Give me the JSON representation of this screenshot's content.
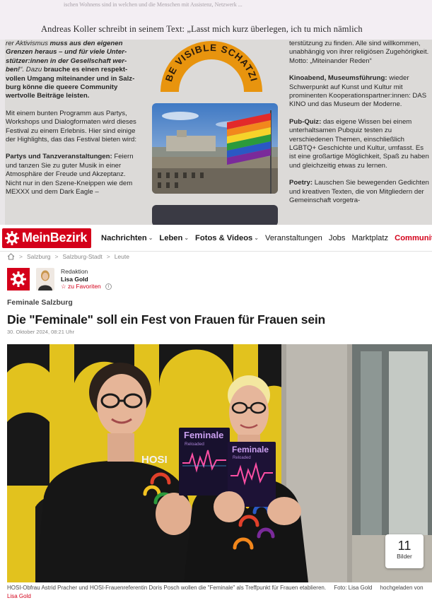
{
  "scan": {
    "faded_text": "ischen Wohnens sind in welchen und die Menschen mit Assistenz, Netzwerk ...",
    "quote_line": "Andreas Koller schreibt in seinem Text: „Lasst mich kurz überlegen, ich tu mich nämlich",
    "left_column": [
      {
        "html_parts": [
          {
            "t": "rer Aktivismus ",
            "s": "i"
          },
          {
            "t": "muss aus den eigenen Grenzen heraus – und für viele Unter­stützer:innen in der Gesellschaft wer­ben!",
            "s": "bi"
          },
          {
            "t": "“. Dazu ",
            "s": "i"
          },
          {
            "t": "brauche es einen respekt­vollen Umgang miteinander und in Salz­burg könne die queere Community wertvolle Beiträge leisten.",
            "s": "b"
          }
        ]
      },
      {
        "html_parts": [
          {
            "t": "Mit einem bunten Programm aus Par­tys, Workshops und Dialogformaten wird dieses Festival zu einem Erlebnis. Hier sind einige der Highlights, das das Festi­val bieten wird:",
            "s": ""
          }
        ]
      },
      {
        "html_parts": [
          {
            "t": "Partys und Tanzveranstaltungen: ",
            "s": "b"
          },
          {
            "t": "Feiern und tanzen Sie zu guter Musik in einer Atmosphäre der Freude und Akzep­tanz. Nicht nur in den Szene-Kneippen wie dem MEXXX und dem Dark Eagle –",
            "s": ""
          }
        ]
      }
    ],
    "right_column": [
      {
        "html_parts": [
          {
            "t": "terstützung zu finden. Alle sind willkom­men, unabhängig von ihrer religiösen Zu­gehörigkeit. Motto: „Miteinander Reden“",
            "s": ""
          }
        ]
      },
      {
        "html_parts": [
          {
            "t": "Kinoabend, Museumsführung: ",
            "s": "b"
          },
          {
            "t": "wieder Schwerpunkt auf Kunst und Kultur mit prominenten Kooperationspartner:in­nen: DAS KINO und das Museum der Moderne.",
            "s": ""
          }
        ]
      },
      {
        "html_parts": [
          {
            "t": "Pub-Quiz: ",
            "s": "b"
          },
          {
            "t": "das eigene Wissen bei ei­nem unterhaltsamen Pubquiz testen zu verschiedenen Themen, einschließlich LGBTQ+ Geschichte und Kultur, umfasst. Es ist eine großartige Möglichkeit, Spaß zu haben und gleichzeitig etwas zu ler­nen.",
            "s": ""
          }
        ]
      },
      {
        "html_parts": [
          {
            "t": "Poetry: ",
            "s": "b"
          },
          {
            "t": "Lauschen Sie bewegenden Gedichten und kreativen Texten, die von Mitgliedern der Gemeinschaft vorgetra-",
            "s": ""
          }
        ]
      }
    ],
    "badge_text": "BE VISIBLE SCHATZI"
  },
  "nav": {
    "logo_text": "MeinBezirk",
    "items": [
      {
        "label": "Nachrichten",
        "chevron": true,
        "style": "bold"
      },
      {
        "label": "Leben",
        "chevron": true,
        "style": "bold"
      },
      {
        "label": "Fotos & Videos",
        "chevron": true,
        "style": "bold"
      },
      {
        "label": "Veranstaltungen",
        "chevron": false,
        "style": ""
      },
      {
        "label": "Jobs",
        "chevron": false,
        "style": ""
      },
      {
        "label": "Marktplatz",
        "chevron": false,
        "style": ""
      },
      {
        "label": "Community",
        "chevron": true,
        "style": "red"
      }
    ]
  },
  "breadcrumb": [
    "Salzburg",
    "Salzburg-Stadt",
    "Leute"
  ],
  "author": {
    "role": "Redaktion",
    "name": "Lisa Gold",
    "favorite": "zu Favoriten",
    "info": "i"
  },
  "article": {
    "tag": "Feminale Salzburg",
    "headline": "Die \"Feminale\" soll ein Fest von Frauen für Frauen sein",
    "date": "30. Oktober 2024, 08:21 Uhr"
  },
  "hero": {
    "gallery_count": "11",
    "gallery_label": "Bilder",
    "flyer_title": "Feminale",
    "flyer_subtitle": "Reloaded",
    "shirt_text": "HOSI"
  },
  "caption": {
    "text": "HOSI-Obfrau Astrid Pracher und HOSI-Frauenreferentin Doris Posch wollen die \"Feminale\" als Treffpunkt für Frauen etablieren.",
    "photo_credit": "Foto: Lisa Gold",
    "uploaded_by": "hochgeladen von",
    "uploader": "Lisa Gold"
  },
  "colors": {
    "brand_red": "#d4001a",
    "text": "#1a1a1a",
    "muted": "#888888"
  }
}
